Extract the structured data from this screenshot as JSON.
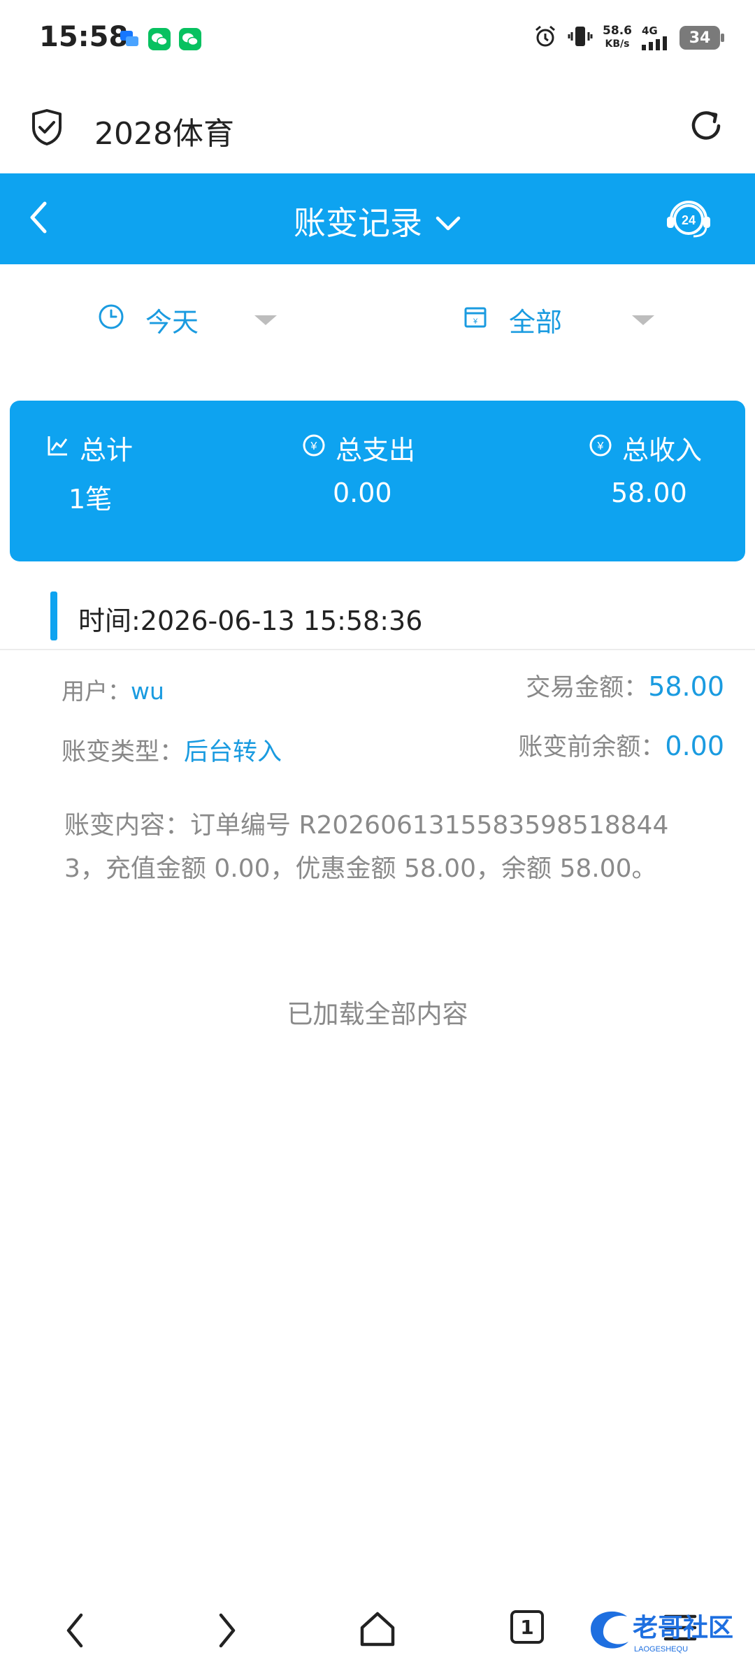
{
  "status_bar": {
    "time": "15:58",
    "net_speed_value": "58.6",
    "net_speed_unit": "KB/s",
    "network": "4G",
    "battery": "34"
  },
  "browser": {
    "title": "2028体育"
  },
  "header": {
    "title": "账变记录"
  },
  "filters": {
    "date": "今天",
    "type": "全部"
  },
  "summary": {
    "total_label": "总计",
    "expense_label": "总支出",
    "income_label": "总收入",
    "total_value": "1笔",
    "expense_value": "0.00",
    "income_value": "58.00"
  },
  "record": {
    "time": "时间:2026-06-13 15:58:36",
    "user_label": "用户：",
    "user_value": "wu",
    "amount_label": "交易金额：",
    "amount_value": "58.00",
    "type_label": "账变类型：",
    "type_value": "后台转入",
    "before_label": "账变前余额：",
    "before_value": "0.00",
    "content": "账变内容：订单编号 R2026061315583598518844 3，充值金额 0.00，优惠金额 58.00，余额 58.00。"
  },
  "list_end": "已加载全部内容",
  "nav": {
    "tab_count": "1"
  },
  "watermark": {
    "text": "老哥社区",
    "sub": "LAOGESHEQU"
  },
  "colors": {
    "accent": "#0ea3f0",
    "link": "#1a9be0",
    "muted": "#8a8a8a"
  }
}
